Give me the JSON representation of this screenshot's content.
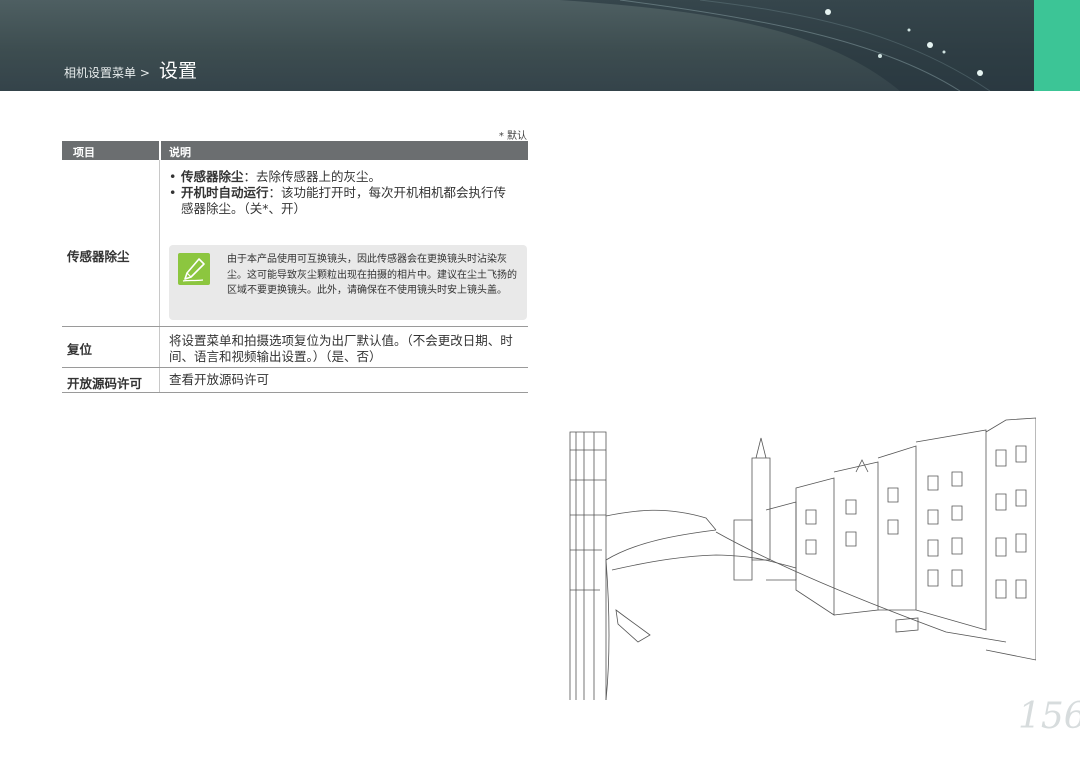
{
  "header": {
    "breadcrumb_parent": "相机设置菜单 >",
    "breadcrumb_current": "设置"
  },
  "default_note": "* 默认",
  "table": {
    "col_item": "项目",
    "col_desc": "说明",
    "rows": [
      {
        "label": "传感器除尘",
        "bullets": [
          {
            "term": "传感器除尘",
            "text": "：去除传感器上的灰尘。"
          },
          {
            "term": "开机时自动运行",
            "text": "：该功能打开时，每次开机相机都会执行传感器除尘。（关*、开）"
          }
        ],
        "note": "由于本产品使用可互换镜头，因此传感器会在更换镜头时沾染灰尘。这可能导致灰尘颗粒出现在拍摄的相片中。建议在尘土飞扬的区域不要更换镜头。此外，请确保在不使用镜头时安上镜头盖。"
      },
      {
        "label": "复位",
        "desc": "将设置菜单和拍摄选项复位为出厂默认值。（不会更改日期、时间、语言和视频输出设置。）（是、否）"
      },
      {
        "label": "开放源码许可",
        "desc": "查看开放源码许可"
      }
    ]
  },
  "page_number": "156",
  "colors": {
    "header_bg": "#3d4d50",
    "accent_tab": "#3cc596",
    "table_header": "#6b6e70",
    "note_icon": "#8cc63f"
  }
}
